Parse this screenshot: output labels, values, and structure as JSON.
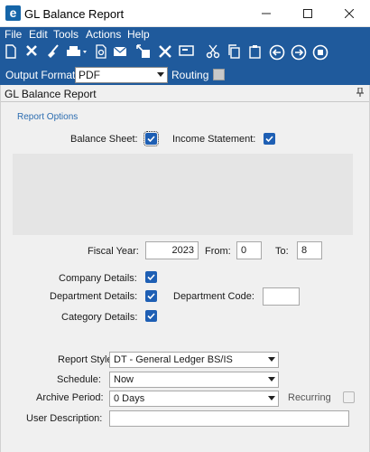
{
  "window": {
    "title": "GL Balance Report",
    "app_icon": "e"
  },
  "menu": [
    "File",
    "Edit",
    "Tools",
    "Actions",
    "Help"
  ],
  "toolbar_icons": [
    "new-icon",
    "delete-icon",
    "clear-icon",
    "print-icon",
    "print-preview-icon",
    "email-icon",
    "export-icon",
    "tools-icon",
    "screen-icon",
    "cut-icon",
    "copy-icon",
    "paste-icon",
    "back-icon",
    "forward-icon",
    "home-icon"
  ],
  "output": {
    "label": "Output Format:",
    "value": "PDF",
    "routing_label": "Routing"
  },
  "panel": {
    "title": "GL Balance Report",
    "section": "Report Options"
  },
  "checks": {
    "balance_sheet": "Balance Sheet:",
    "income_statement": "Income Statement:",
    "company_details": "Company Details:",
    "department_details": "Department Details:",
    "category_details": "Category Details:"
  },
  "fiscal": {
    "year_label": "Fiscal Year:",
    "year": "2023",
    "from_label": "From:",
    "from": "0",
    "to_label": "To:",
    "to": "8"
  },
  "department_code": {
    "label": "Department Code:",
    "value": ""
  },
  "report_style": {
    "label": "Report Style:",
    "value": "DT - General Ledger BS/IS"
  },
  "schedule": {
    "label": "Schedule:",
    "value": "Now"
  },
  "archive": {
    "label": "Archive Period:",
    "value": "0 Days",
    "recurring_label": "Recurring"
  },
  "user_description": {
    "label": "User Description:",
    "value": ""
  }
}
